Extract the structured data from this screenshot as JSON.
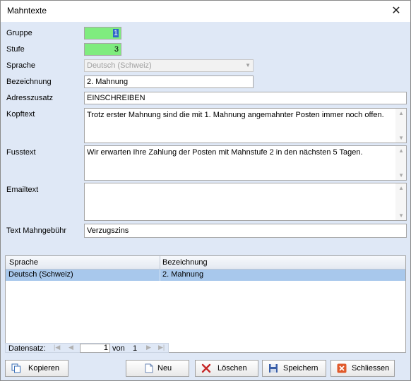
{
  "window": {
    "title": "Mahntexte",
    "close_glyph": "✕"
  },
  "form": {
    "gruppe": {
      "label": "Gruppe",
      "value": "1"
    },
    "stufe": {
      "label": "Stufe",
      "value": "3"
    },
    "sprache": {
      "label": "Sprache",
      "value": "Deutsch (Schweiz)"
    },
    "bezeichnung": {
      "label": "Bezeichnung",
      "value": "2. Mahnung"
    },
    "adresszusatz": {
      "label": "Adresszusatz",
      "value": "EINSCHREIBEN"
    },
    "kopftext": {
      "label": "Kopftext",
      "value": "Trotz erster Mahnung sind die mit 1. Mahnung angemahnter Posten immer noch offen."
    },
    "fusstext": {
      "label": "Fusstext",
      "value": "Wir erwarten Ihre Zahlung der Posten mit Mahnstufe 2 in den nächsten 5 Tagen."
    },
    "emailtext": {
      "label": "Emailtext",
      "value": ""
    },
    "text_mahngebuehr": {
      "label": "Text Mahngebühr",
      "value": "Verzugszins"
    }
  },
  "grid": {
    "columns": [
      "Sprache",
      "Bezeichnung"
    ],
    "rows": [
      [
        "Deutsch (Schweiz)",
        "2. Mahnung"
      ]
    ]
  },
  "navigator": {
    "label": "Datensatz:",
    "current": "1",
    "of_label": "von",
    "total": "1"
  },
  "buttons": {
    "kopieren": "Kopieren",
    "neu": "Neu",
    "loeschen": "Löschen",
    "speichern": "Speichern",
    "schliessen": "Schliessen"
  },
  "colors": {
    "highlight_green": "#7fec7f",
    "client_bg": "#dfe8f6",
    "row_selected": "#a8c8ec"
  }
}
